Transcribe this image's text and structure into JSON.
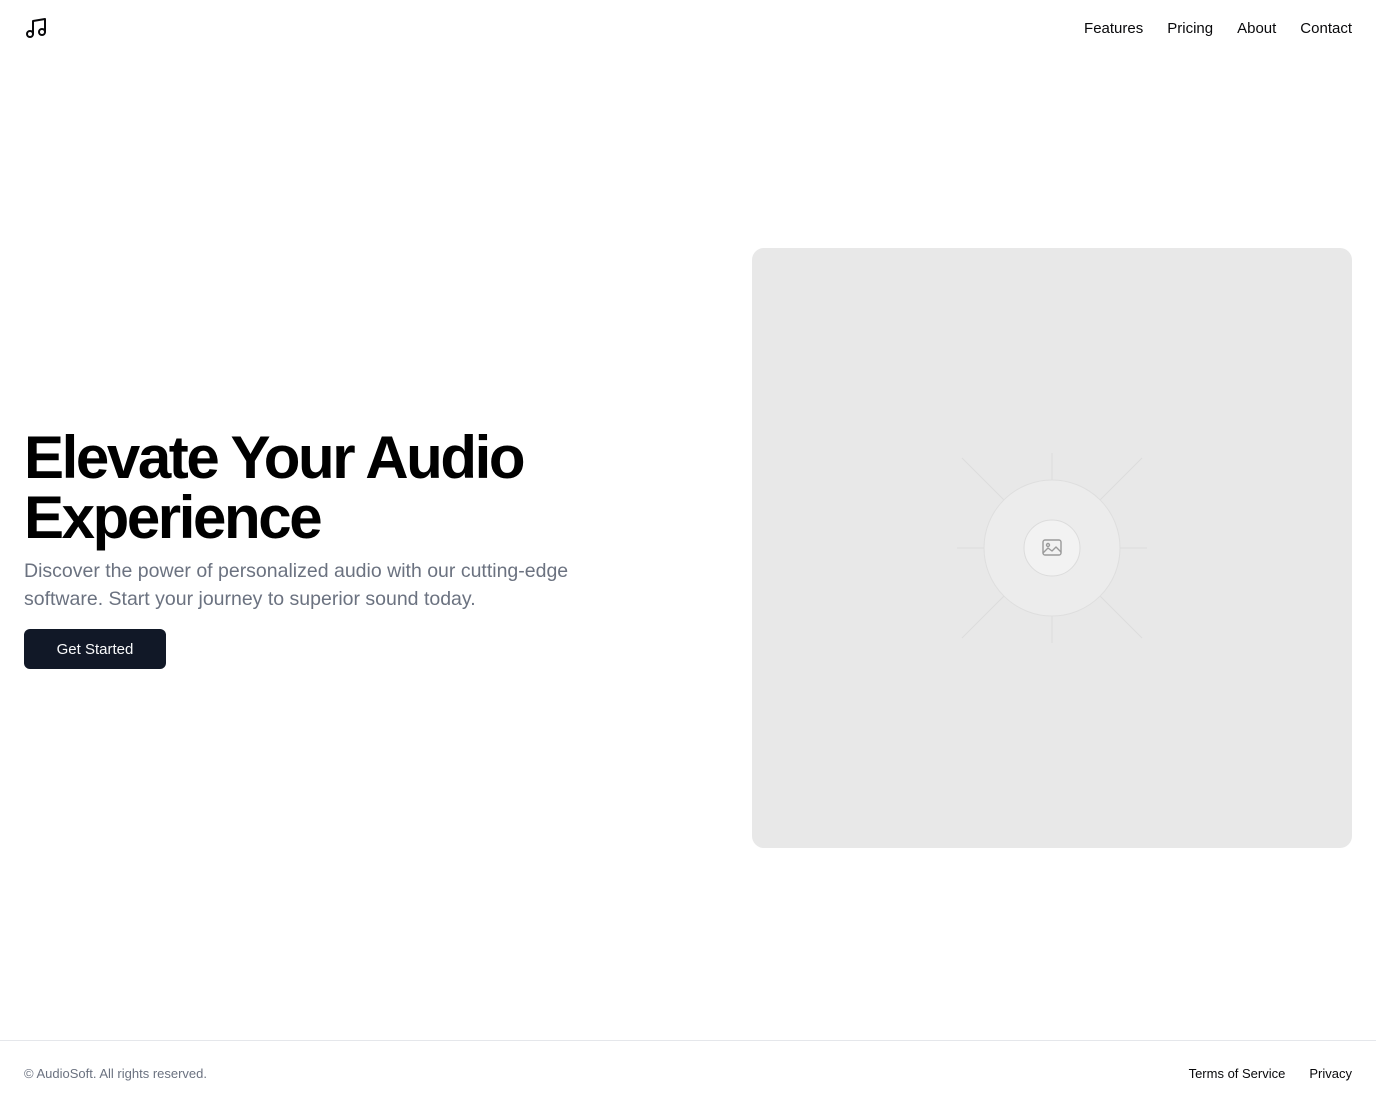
{
  "header": {
    "logo_icon": "music-note-icon",
    "nav": [
      {
        "label": "Features"
      },
      {
        "label": "Pricing"
      },
      {
        "label": "About"
      },
      {
        "label": "Contact"
      }
    ]
  },
  "hero": {
    "title_line1": "Elevate Your Audio",
    "title_line2": "Experience",
    "subtitle": "Discover the power of personalized audio with our cutting-edge software. Start your journey to superior sound today.",
    "cta_label": "Get Started",
    "image_icon": "image-placeholder-icon"
  },
  "footer": {
    "copyright": "© AudioSoft. All rights reserved.",
    "links": [
      {
        "label": "Terms of Service"
      },
      {
        "label": "Privacy"
      }
    ]
  },
  "colors": {
    "background": "#ffffff",
    "text": "#09090b",
    "muted": "#6b7280",
    "button_bg": "#111827",
    "button_text": "#f9fafb",
    "placeholder_bg": "#e8e8e8",
    "border": "#e5e7eb"
  }
}
